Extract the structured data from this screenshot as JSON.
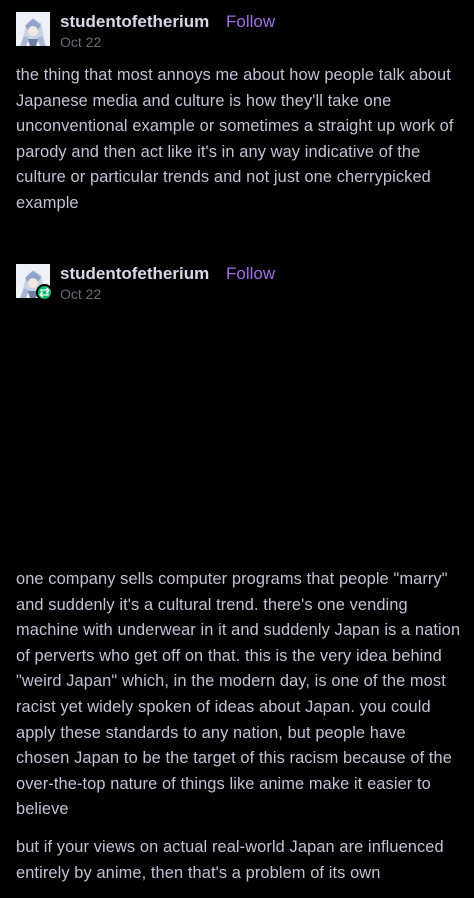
{
  "posts": [
    {
      "username": "studentofetherium",
      "follow_label": "Follow",
      "date": "Oct 22",
      "reblogged": false,
      "paragraphs": [
        "the thing that most annoys me about how people talk about Japanese media and culture is how they'll take one unconventional example or sometimes a straight up work of parody and then act like it's in any way indicative of the culture or particular trends and not just one cherrypicked example"
      ]
    },
    {
      "username": "studentofetherium",
      "follow_label": "Follow",
      "date": "Oct 22",
      "reblogged": true,
      "paragraphs": [
        "one company sells computer programs that people \"marry\" and suddenly it's a cultural trend. there's one vending machine with underwear in it and suddenly Japan is a nation of perverts who get off on that. this is the very idea behind \"weird Japan\" which, in the modern day, is one of the most racist yet widely spoken of ideas about Japan. you could apply these standards to any nation, but people have chosen Japan to be the target of this racism because of the over-the-top nature of things like anime make it easier to believe",
        "but if your views on actual real-world Japan are influenced entirely by anime, then that's a problem of its own"
      ]
    }
  ],
  "colors": {
    "background": "#000000",
    "text": "#c8bfd6",
    "username": "#ddd6e8",
    "follow": "#a46de8",
    "date": "#6f687a",
    "reblog_badge": "#00b96b"
  },
  "icons": {
    "avatar": "anime-character-avatar",
    "reblog": "reblog-icon"
  }
}
